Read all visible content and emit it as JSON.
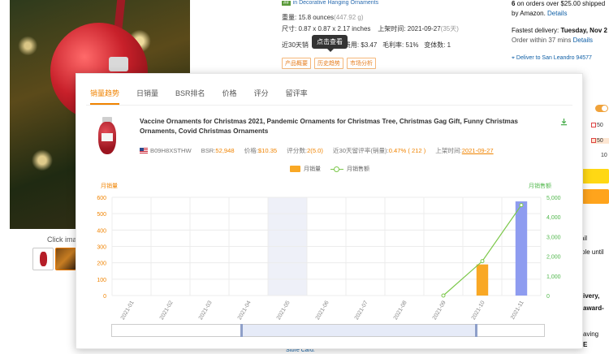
{
  "background": {
    "mid": {
      "line1_tag": "##",
      "line1_text": "in Decorative Hanging Ornaments",
      "weight": "重量: 15.8 ounces",
      "weight_note": "(447.92 g)",
      "size": "尺寸: 0.87 x 0.87 x 2.17 inches",
      "listed": "上架时间: 2021-09-27",
      "listed_note": "(35天)",
      "line4_a": "近30天销",
      "line4_b": "BA费用: $3.47",
      "line4_c": "毛利率: 51%",
      "line4_d": "变体数: 1",
      "btn_overview": "产品概要",
      "btn_history": "历史趋势",
      "btn_market": "市场分析",
      "tooltip": "点击查看"
    },
    "right": {
      "line1_bold": "6",
      "line1": " on orders over $25.00 shipped",
      "line2": "by Amazon. ",
      "details": "Details",
      "fastest": "Fastest delivery: ",
      "fastest_bold": "Tuesday, Nov 2",
      "order_within": "Order within 37 mins ",
      "deliver": "Deliver to San Leandro 94577",
      "mini1": "50",
      "mini2": "50",
      "mini3": "10",
      "frag_ail": "ail",
      "frag_ple": "ple until",
      "frag_ivery": "ivery,",
      "frag_award": "award-",
      "frag_aving": "aving",
      "frag_e": "E"
    },
    "left": {
      "click_image": "Click ima"
    },
    "store_card": "Store Card."
  },
  "panel": {
    "tabs": [
      "销量趋势",
      "日销量",
      "BSR排名",
      "价格",
      "评分",
      "留评率"
    ],
    "product": {
      "title": "Vaccine Ornaments for Christmas 2021, Pandemic Ornaments for Christmas Tree, Christmas Gag Gift, Funny Christmas Ornaments, Covid Christmas Ornaments",
      "asin": "B09H8XSTHW",
      "bsr_label": "BSR: ",
      "bsr_value": "52,948",
      "price_label": "价格: ",
      "price_value": "$10.35",
      "rating_label": "评分数: ",
      "rating_value": "2(5.0)",
      "review_rate_label": "近30天留评率(销量): ",
      "review_rate_value": "0.47% ( 212 )",
      "listed_label": "上架时间: ",
      "listed_value": "2021-09-27"
    },
    "legend": {
      "bar": "月销量",
      "line": "月销售额"
    }
  },
  "chart_data": {
    "type": "bar",
    "categories": [
      "2021-01",
      "2021-02",
      "2021-03",
      "2021-04",
      "2021-05",
      "2021-06",
      "2021-07",
      "2021-08",
      "2021-09",
      "2021-10",
      "2021-11"
    ],
    "series": [
      {
        "name": "月销量",
        "type": "bar",
        "axis": "left",
        "color": "#f9a825",
        "values": [
          0,
          0,
          0,
          0,
          0,
          0,
          0,
          0,
          0,
          190,
          0
        ]
      },
      {
        "name": "月销量",
        "type": "bar",
        "axis": "left",
        "color": "#8e9cf0",
        "values": [
          0,
          0,
          0,
          0,
          0,
          0,
          0,
          0,
          0,
          0,
          575
        ]
      },
      {
        "name": "月销售额",
        "type": "line",
        "axis": "right",
        "color": "#7cc84a",
        "values": [
          null,
          null,
          null,
          null,
          null,
          null,
          null,
          null,
          0,
          1750,
          4600
        ]
      }
    ],
    "ylabel_left": "月销量",
    "ylabel_right": "月销售额",
    "yticks_left": [
      0,
      100,
      200,
      300,
      400,
      500,
      600
    ],
    "yticks_right": [
      0,
      1000,
      2000,
      3000,
      4000,
      5000
    ],
    "ylim_left": [
      0,
      600
    ],
    "ylim_right": [
      0,
      5000
    ],
    "highlight_category": "2021-05",
    "grid": true
  },
  "colors": {
    "accent": "#f08300",
    "green": "#52b84d",
    "bar_orange": "#f9a825",
    "bar_blue": "#8e9cf0"
  }
}
